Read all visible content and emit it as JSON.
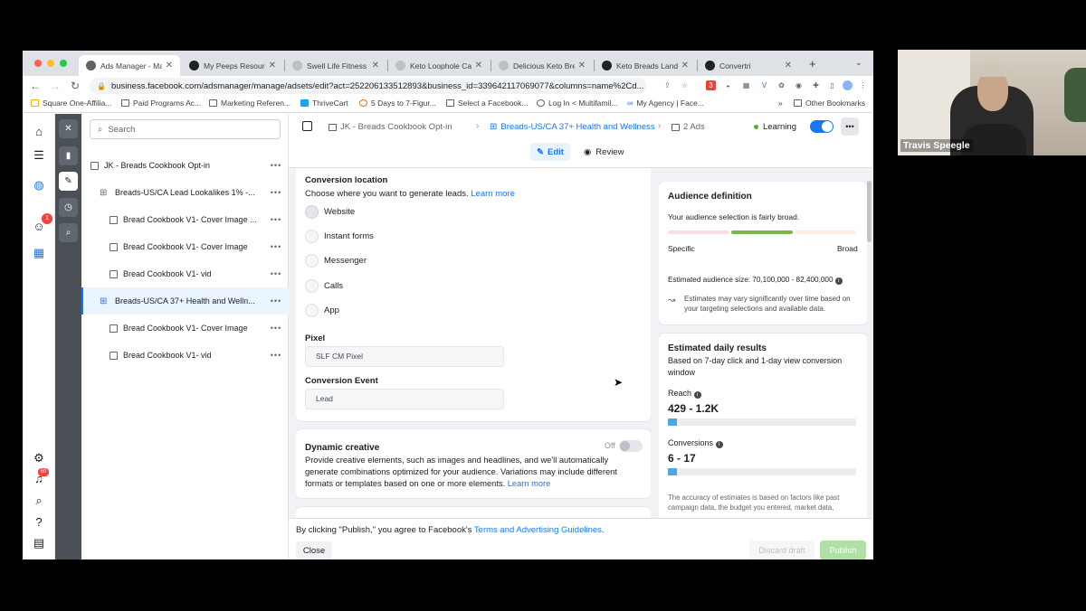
{
  "browser": {
    "tabs": [
      {
        "label": "Ads Manager - Ma",
        "active": true
      },
      {
        "label": "My Peeps Resourc"
      },
      {
        "label": "Swell Life Fitness"
      },
      {
        "label": "Keto Loophole Cal"
      },
      {
        "label": "Delicious Keto Bre"
      },
      {
        "label": "Keto Breads Land"
      },
      {
        "label": "Convertri"
      }
    ],
    "new_tab": "+",
    "url": "business.facebook.com/adsmanager/manage/adsets/edit?act=252206133512893&business_id=339642117069077&columns=name%2Cd...",
    "bookmarks": [
      "Square One-Affilia...",
      "Paid Programs Ac...",
      "Marketing Referen...",
      "ThriveCart",
      "5 Days to 7-Figur...",
      "Select a Facebook...",
      "Log In < Multifamil...",
      "My Agency | Face..."
    ],
    "bookmarks_more": "»",
    "other_bookmarks": "Other Bookmarks",
    "extension_badge": "3"
  },
  "icon_rail": {
    "notification_badge": "1",
    "alerts_badge": "60"
  },
  "tree": {
    "search_placeholder": "Search",
    "rows": [
      {
        "label": "JK - Breads Cookbook Opt-in",
        "more": "•••"
      },
      {
        "label": "Breads-US/CA Lead Lookalikes 1% -...",
        "more": "•••"
      },
      {
        "label": "Bread Cookbook V1- Cover Image ...",
        "more": "•••"
      },
      {
        "label": "Bread Cookbook V1- Cover Image",
        "more": "•••"
      },
      {
        "label": "Bread Cookbook V1- vid",
        "more": "•••"
      },
      {
        "label": "Breads-US/CA 37+ Health and Welln...",
        "more": "•••"
      },
      {
        "label": "Bread Cookbook V1- Cover Image",
        "more": "•••"
      },
      {
        "label": "Bread Cookbook V1- vid",
        "more": "•••"
      }
    ]
  },
  "header": {
    "breadcrumb_campaign": "JK - Breads Cookbook Opt-in",
    "breadcrumb_adset": "Breads-US/CA 37+ Health and Wellness",
    "breadcrumb_ads": "2 Ads",
    "learning": "Learning",
    "more": "•••",
    "edit_tab": "Edit",
    "review_tab": "Review"
  },
  "form": {
    "conversion_location_title": "Conversion location",
    "conversion_location_desc": "Choose where you want to generate leads.",
    "learn_more": "Learn more",
    "options": [
      "Website",
      "Instant forms",
      "Messenger",
      "Calls",
      "App"
    ],
    "pixel_label": "Pixel",
    "pixel_value": "SLF CM Pixel",
    "event_label": "Conversion Event",
    "event_value": "Lead",
    "dynamic_title": "Dynamic creative",
    "dynamic_state": "Off",
    "dynamic_desc": "Provide creative elements, such as images and headlines, and we'll automatically generate combinations optimized for your audience. Variations may include different formats or templates based on one or more elements.",
    "dynamic_learn_more": "Learn more"
  },
  "audience": {
    "title": "Audience definition",
    "summary": "Your audience selection is fairly broad.",
    "specific": "Specific",
    "broad": "Broad",
    "size_label": "Estimated audience size: 70,100,000 - 82,400,000",
    "note": "Estimates may vary significantly over time based on your targeting selections and available data."
  },
  "daily": {
    "title": "Estimated daily results",
    "desc": "Based on 7-day click and 1-day view conversion window",
    "reach_label": "Reach",
    "reach_value": "429 - 1.2K",
    "reach_fill": 0.05,
    "conv_label": "Conversions",
    "conv_value": "6 - 17",
    "conv_fill": 0.05,
    "disclaimer": "The accuracy of estimates is based on factors like past campaign data, the budget you entered, market data,"
  },
  "footer": {
    "agree_prefix": "By clicking \"Publish,\" you agree to Facebook's",
    "agree_link": "Terms and Advertising Guidelines",
    "agree_suffix": ".",
    "close": "Close",
    "discard": "Discard draft",
    "publish": "Publish"
  },
  "webcam": {
    "name": "Travis Speegle"
  },
  "colors": {
    "brand": "#1877f2",
    "learning": "#42b72a",
    "meter_active": "#7ab648"
  }
}
